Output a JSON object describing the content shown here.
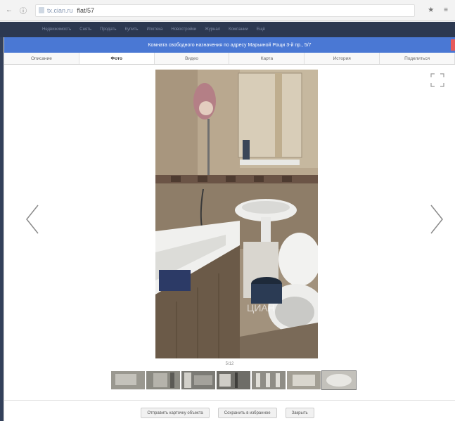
{
  "browser": {
    "back": "←",
    "info": "ⓘ",
    "domain": "tx.cian.ru",
    "path": "flat/57",
    "bookmark": "★",
    "menu": "≡"
  },
  "site_strip": {
    "items": [
      "Недвижимость",
      "Снять",
      "Продать",
      "Купить",
      "Ипотека",
      "Новостройки",
      "Журнал",
      "Компании",
      "Ещё"
    ]
  },
  "modal": {
    "title": "Комната свободного назначения по адресу Марьиной Рощи 3-й пр., 5/7",
    "tabs": [
      {
        "label": "Описание"
      },
      {
        "label": "Фото"
      },
      {
        "label": "Видео"
      },
      {
        "label": "Карта"
      },
      {
        "label": "История"
      },
      {
        "label": "Поделиться"
      }
    ],
    "active_tab": 1,
    "counter": "5/12",
    "watermark": "ЦИАН",
    "footer": {
      "btn1": "Отправить карточку объекта",
      "btn2": "Сохранить в избранное",
      "btn3": "Закрыть"
    }
  },
  "colors": {
    "title_bar": "#4a78d4",
    "close": "#e85a5a",
    "site_strip": "#2c3850"
  }
}
